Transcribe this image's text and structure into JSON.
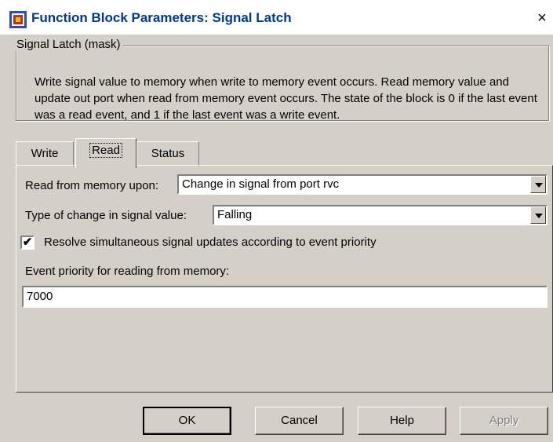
{
  "window": {
    "title": "Function Block Parameters: Signal Latch",
    "close_glyph": "×"
  },
  "group": {
    "legend": "Signal Latch (mask)",
    "description": "Write signal value to memory when write to memory event occurs. Read memory value and update out port when read from memory event occurs. The state of the block is 0 if the last event was a read event, and 1 if the last event was a write event."
  },
  "tabs": [
    {
      "label": "Write"
    },
    {
      "label": "Read"
    },
    {
      "label": "Status"
    }
  ],
  "read_tab": {
    "read_upon_label": "Read from memory upon:",
    "read_upon_value": "Change in signal from port rvc",
    "change_type_label": "Type of change in signal value:",
    "change_type_value": "Falling",
    "resolve_checked": true,
    "resolve_label": "Resolve simultaneous signal updates according to event priority",
    "priority_label": "Event priority for reading from memory:",
    "priority_value": "7000"
  },
  "buttons": {
    "ok": "OK",
    "cancel": "Cancel",
    "help": "Help",
    "apply": "Apply"
  },
  "colors": {
    "dialog_bg": "#d4d0c8",
    "title_text": "#003a8c"
  },
  "icons": {
    "app": "simulink-block-icon",
    "check": "✔"
  }
}
